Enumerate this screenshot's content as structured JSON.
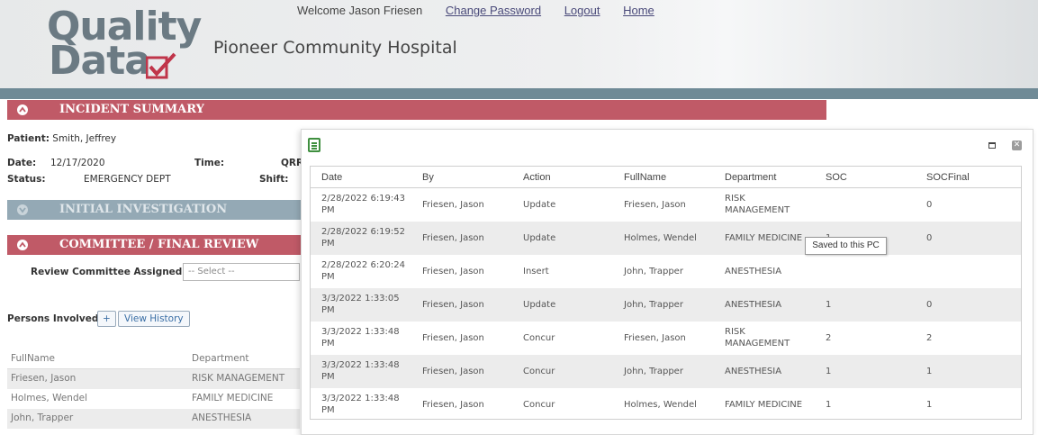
{
  "header": {
    "logo_line1": "Quality",
    "logo_line2": "Data",
    "hospital": "Pioneer Community Hospital",
    "welcome": "Welcome Jason Friesen",
    "links": [
      "Change Password",
      "Logout",
      "Home"
    ]
  },
  "incident_summary": {
    "title": "INCIDENT SUMMARY",
    "patient_label": "Patient:",
    "patient": "Smith, Jeffrey",
    "date_label": "Date:",
    "date": "12/17/2020",
    "time_label": "Time:",
    "time_partial": "QRR",
    "status_label": "Status:",
    "status": "EMERGENCY DEPT",
    "shift_label": "Shift:"
  },
  "initial_investigation": {
    "title": "INITIAL INVESTIGATION"
  },
  "committee": {
    "title": "COMMITTEE / FINAL REVIEW",
    "review_label": "Review Committee Assigned:",
    "review_placeholder": "-- Select --"
  },
  "persons": {
    "label": "Persons Involved",
    "add": "+",
    "view_history": "View History",
    "columns": [
      "FullName",
      "Department"
    ],
    "rows": [
      [
        "Friesen, Jason",
        "RISK MANAGEMENT"
      ],
      [
        "Holmes, Wendel",
        "FAMILY MEDICINE"
      ],
      [
        "John, Trapper",
        "ANESTHESIA"
      ]
    ]
  },
  "history_modal": {
    "close_glyph": "✕",
    "columns": [
      "Date",
      "By",
      "Action",
      "FullName",
      "Department",
      "SOC",
      "SOCFinal"
    ],
    "rows": [
      {
        "date1": "2/28/2022 6:19:43",
        "date2": "PM",
        "by": "Friesen, Jason",
        "action": "Update",
        "fullname": "Friesen, Jason",
        "dept1": "RISK",
        "dept2": "MANAGEMENT",
        "soc": "",
        "socfinal": "0"
      },
      {
        "date1": "2/28/2022 6:19:52",
        "date2": "PM",
        "by": "Friesen, Jason",
        "action": "Update",
        "fullname": "Holmes, Wendel",
        "dept1": "FAMILY MEDICINE",
        "dept2": "",
        "soc": "1",
        "socfinal": "0"
      },
      {
        "date1": "2/28/2022 6:20:24",
        "date2": "PM",
        "by": "Friesen, Jason",
        "action": "Insert",
        "fullname": "John, Trapper",
        "dept1": "ANESTHESIA",
        "dept2": "",
        "soc": "",
        "socfinal": ""
      },
      {
        "date1": "3/3/2022 1:33:05",
        "date2": "PM",
        "by": "Friesen, Jason",
        "action": "Update",
        "fullname": "John, Trapper",
        "dept1": "ANESTHESIA",
        "dept2": "",
        "soc": "1",
        "socfinal": "0"
      },
      {
        "date1": "3/3/2022 1:33:48",
        "date2": "PM",
        "by": "Friesen, Jason",
        "action": "Concur",
        "fullname": "Friesen, Jason",
        "dept1": "RISK",
        "dept2": "MANAGEMENT",
        "soc": "2",
        "socfinal": "2"
      },
      {
        "date1": "3/3/2022 1:33:48",
        "date2": "PM",
        "by": "Friesen, Jason",
        "action": "Concur",
        "fullname": "John, Trapper",
        "dept1": "ANESTHESIA",
        "dept2": "",
        "soc": "1",
        "socfinal": "1"
      },
      {
        "date1": "3/3/2022 1:33:48",
        "date2": "PM",
        "by": "Friesen, Jason",
        "action": "Concur",
        "fullname": "Holmes, Wendel",
        "dept1": "FAMILY MEDICINE",
        "dept2": "",
        "soc": "1",
        "socfinal": "1"
      }
    ],
    "tooltip": "Saved to this PC"
  },
  "colors": {
    "section_red": "#c05a67",
    "section_blue": "#94a9b5",
    "header_stripe": "#6f8a96",
    "logo_check": "#c0354a"
  }
}
